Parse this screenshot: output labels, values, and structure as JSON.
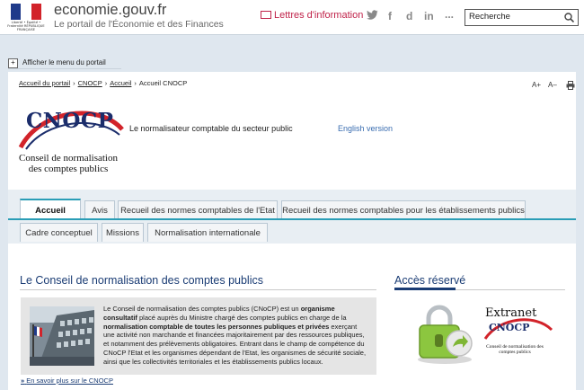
{
  "header": {
    "marianne_text": "Liberté • Égalité • Fraternité RÉPUBLIQUE FRANÇAISE",
    "site_title": "economie.gouv.fr",
    "site_subtitle": "Le portail de l'Économie et des Finances",
    "newsletter": "Lettres d'information",
    "social": [
      "twitter-icon",
      "facebook-icon",
      "dailymotion-icon",
      "linkedin-icon",
      "more-icon"
    ],
    "social_glyphs": [
      "🐦",
      "f",
      "d",
      "in",
      "..."
    ],
    "search_placeholder": "Recherche",
    "colors": {
      "flag_blue": "#1f3a8a",
      "flag_red": "#d2232a",
      "accent": "#c0234a"
    }
  },
  "portal": {
    "toggle_label": "Afficher le menu du portail"
  },
  "breadcrumb": {
    "items": [
      "Accueil du portail",
      "CNOCP",
      "Accueil",
      "Accueil CNOCP"
    ],
    "separator": "›"
  },
  "tools": {
    "zoom_in": "A+",
    "zoom_out": "A–"
  },
  "logo": {
    "acronym": "CNOCP",
    "subtitle_line1": "Conseil de normalisation",
    "subtitle_line2": "des comptes publics"
  },
  "tagline": "Le normalisateur comptable du secteur public",
  "english_link": "English version",
  "tabs_row1": [
    "Accueil",
    "Avis",
    "Recueil des normes comptables de l'Etat",
    "Recueil des normes comptables pour les établissements publics"
  ],
  "tabs_row2": [
    "Cadre conceptuel",
    "Missions",
    "Normalisation internationale"
  ],
  "active_tab": "Accueil",
  "accent_color": "#2a9db6",
  "main": {
    "section_title": "Le Conseil de normalisation des comptes publics",
    "intro_p1": "Le Conseil de normalisation des comptes publics (CNoCP) est un ",
    "intro_b1": "organisme consultatif",
    "intro_p2": " placé auprès du Ministre chargé des comptes publics en charge de la ",
    "intro_b2": "normalisation comptable de toutes les personnes publiques et privées",
    "intro_p3": " exerçant une activité non marchande et financées majoritairement par des ressources publiques, et notamment des prélèvements obligatoires. Entrant dans le champ de compétence du CNoCP l'Etat et les organismes dépendant de l'Etat, les organismes de sécurité sociale, ainsi que les collectivités territoriales et les établissements publics locaux.",
    "more_arrow": "»",
    "more_link": "En savoir plus sur le CNOCP"
  },
  "sidebar": {
    "title": "Accès réservé",
    "extranet_label": "Extranet",
    "extranet_acronym": "CNOCP",
    "extranet_sub": "Conseil de normalisation des comptes publics"
  }
}
